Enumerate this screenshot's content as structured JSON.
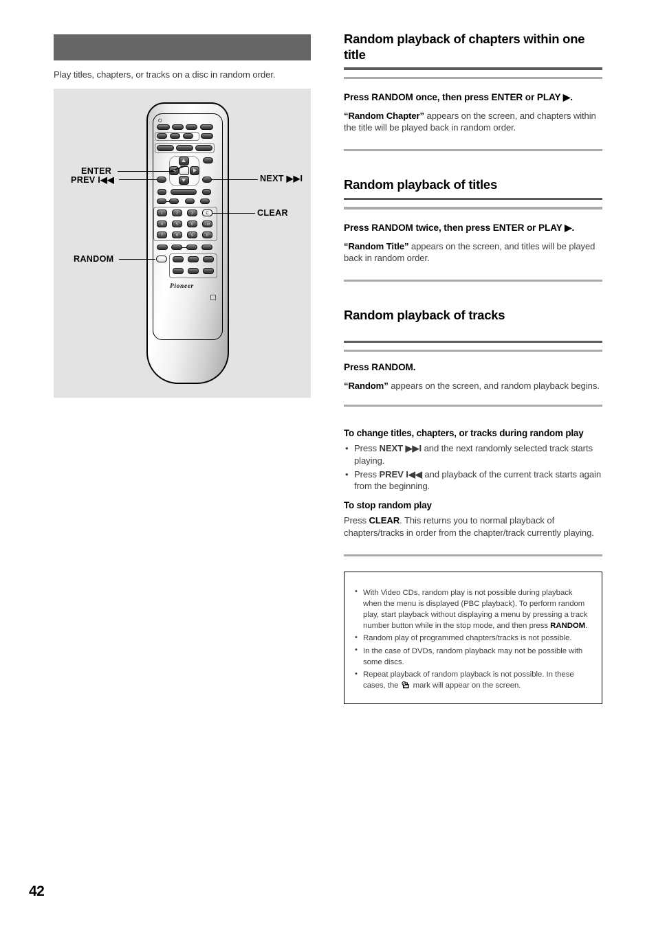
{
  "page": {
    "number": "42"
  },
  "left": {
    "header_bar_label": "",
    "intro": "Play titles, chapters, or tracks on a disc in random order.",
    "figure": {
      "name": "remote-control-diagram",
      "brand": "Pioneer",
      "callouts": [
        {
          "id": "enter",
          "label": "ENTER"
        },
        {
          "id": "prev",
          "label": "PREV I◀◀"
        },
        {
          "id": "next",
          "label": "NEXT ▶▶I"
        },
        {
          "id": "clear",
          "label": "CLEAR"
        },
        {
          "id": "random",
          "label": "RANDOM"
        }
      ],
      "number_buttons": [
        "1",
        "2",
        "3",
        "C",
        "4",
        "5",
        "6",
        "+10",
        "7",
        "8",
        "9",
        "0"
      ]
    }
  },
  "right": {
    "sections": [
      {
        "id": "random-chapters",
        "title": "Random playback of chapters within one title",
        "step": "Press RANDOM once, then press ENTER or PLAY ▶.",
        "body_bold": "“Random Chapter”",
        "body_rest": " appears on the screen, and chapters within the title will be played back in random order."
      },
      {
        "id": "random-titles",
        "title": "Random playback of titles",
        "step": "Press RANDOM twice, then press ENTER or PLAY ▶.",
        "body_bold": "“Random Title”",
        "body_rest": " appears on the screen, and titles will be played back in random order."
      },
      {
        "id": "random-tracks",
        "title": "Random playback of tracks",
        "step": "Press RANDOM.",
        "body_bold": "“Random”",
        "body_rest": " appears on the screen, and random playback begins."
      }
    ],
    "change_block": {
      "heading": "To change titles, chapters, or tracks during random play",
      "bullets": [
        {
          "pre": "Press ",
          "bold": "NEXT ▶▶I",
          "post": " and the next randomly selected track starts playing."
        },
        {
          "pre": "Press ",
          "bold": "PREV I◀◀",
          "post": " and playback of the current track starts again from the beginning."
        }
      ]
    },
    "stop_block": {
      "heading": "To stop random play",
      "pre": "Press ",
      "bold": "CLEAR",
      "post": ". This returns you to normal playback of chapters/tracks in order from the chapter/track currently playing."
    },
    "note_box": {
      "items": [
        {
          "pre": "With Video CDs, random play is not possible during playback when the menu is displayed (PBC playback). To perform random play, start playback without displaying a menu by pressing a track number button while in the stop mode, and then press ",
          "bold": "RANDOM",
          "post": "."
        },
        {
          "pre": "Random play of programmed chapters/tracks is not possible.",
          "bold": "",
          "post": ""
        },
        {
          "pre": "In the case of DVDs, random playback may not be possible with some discs.",
          "bold": "",
          "post": ""
        },
        {
          "pre": "Repeat playback of random playback is not possible. In these cases, the ",
          "bold": "",
          "post": " mark will appear on the screen.",
          "has_icon": true,
          "icon_name": "prohibited-operation-mark"
        }
      ]
    }
  },
  "colors": {
    "header_bar": "#666666",
    "figure_bg": "#e3e3e3",
    "rule_dark": "#5b5b5b",
    "rule_light": "#a9a9a9",
    "body_text": "#3d3d3d",
    "heading_text": "#000000"
  }
}
